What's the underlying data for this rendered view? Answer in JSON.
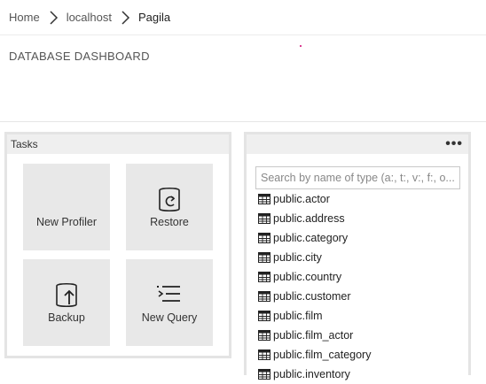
{
  "breadcrumb": [
    "Home",
    "localhost",
    "Pagila"
  ],
  "page_title": "DATABASE DASHBOARD",
  "tasks": {
    "title": "Tasks",
    "tiles": [
      {
        "label": "New Profiler",
        "icon": "profiler-icon"
      },
      {
        "label": "Restore",
        "icon": "restore-icon"
      },
      {
        "label": "Backup",
        "icon": "backup-icon"
      },
      {
        "label": "New Query",
        "icon": "new-query-icon"
      }
    ]
  },
  "explorer": {
    "more_label": "•••",
    "search_placeholder": "Search by name of type (a:, t:, v:, f:, o...",
    "items": [
      "public.actor",
      "public.address",
      "public.category",
      "public.city",
      "public.country",
      "public.customer",
      "public.film",
      "public.film_actor",
      "public.film_category",
      "public.inventory"
    ],
    "item_icon": "table-icon"
  },
  "colors": {
    "accent_dot": "#d0006f",
    "tile_bg": "#e8e8e8",
    "header_bg": "#efefef"
  }
}
